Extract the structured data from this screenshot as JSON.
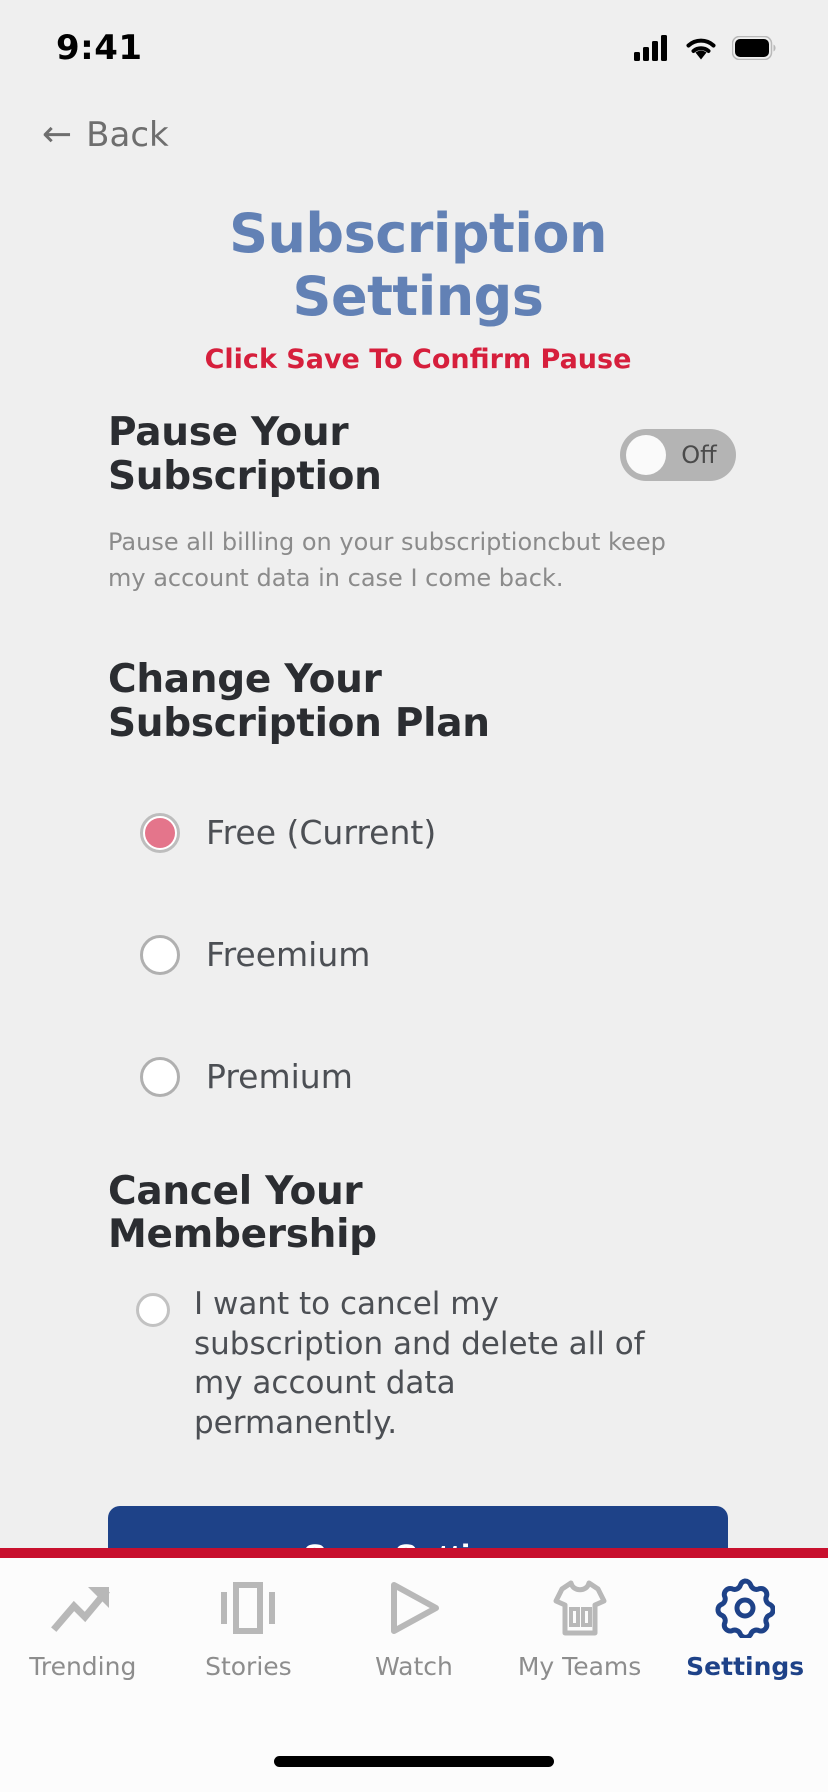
{
  "status_bar": {
    "time": "9:41",
    "icons": [
      "cellular-signal-icon",
      "wifi-icon",
      "battery-icon"
    ]
  },
  "nav": {
    "back_label": "Back",
    "back_icon": "arrow-left-icon"
  },
  "header": {
    "title": "Subscription Settings",
    "subtitle": "Click Save To Confirm Pause",
    "title_color": "#6281b5",
    "subtitle_color": "#d61f3c"
  },
  "pause_section": {
    "heading": "Pause Your Subscription",
    "description": "Pause all billing on your subscriptioncbut keep my account data in case I come back.",
    "toggle": {
      "state_label": "Off",
      "checked": false,
      "track_color": "#b4b4b4",
      "knob_color": "#fafafa"
    }
  },
  "plan_section": {
    "heading": "Change Your Subscription Plan",
    "selected_color": "#e4758b",
    "options": [
      {
        "label": "Free (Current)",
        "selected": true
      },
      {
        "label": "Freemium",
        "selected": false
      },
      {
        "label": "Premium",
        "selected": false
      }
    ]
  },
  "cancel_section": {
    "heading": "Cancel Your Membership",
    "option_label": "I want to cancel my subscription and delete all of my account data permanently.",
    "selected": false
  },
  "actions": {
    "save_label": "Save Settings",
    "save_color": "#1e4288"
  },
  "tab_bar": {
    "accent_bar_color": "#c8102e",
    "active_color": "#1e4288",
    "inactive_color": "#8d8d8d",
    "tabs": [
      {
        "label": "Trending",
        "icon": "trending-arrow-icon",
        "active": false
      },
      {
        "label": "Stories",
        "icon": "stories-carousel-icon",
        "active": false
      },
      {
        "label": "Watch",
        "icon": "play-triangle-icon",
        "active": false
      },
      {
        "label": "My Teams",
        "icon": "jersey-icon",
        "active": false
      },
      {
        "label": "Settings",
        "icon": "gear-icon",
        "active": true
      }
    ]
  }
}
